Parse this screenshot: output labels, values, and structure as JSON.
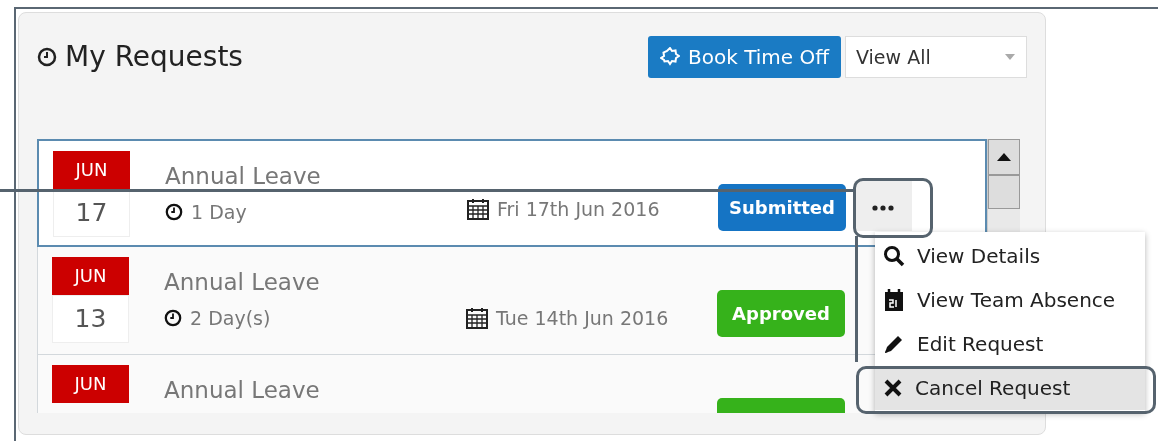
{
  "panel": {
    "title": "My Requests",
    "book_button": "Book Time Off",
    "filter": {
      "value": "View All"
    }
  },
  "requests": [
    {
      "month": "JUN",
      "day": "17",
      "title": "Annual Leave",
      "duration": "1 Day",
      "date": "Fri 17th Jun 2016",
      "status": {
        "kind": "submitted",
        "label": "Submitted"
      },
      "selected": true,
      "menu_open": true
    },
    {
      "month": "JUN",
      "day": "13",
      "title": "Annual Leave",
      "duration": "2 Day(s)",
      "date": "Tue 14th Jun 2016",
      "status": {
        "kind": "approved",
        "label": "Approved"
      },
      "selected": false,
      "menu_open": false
    },
    {
      "month": "JUN",
      "title": "Annual Leave",
      "status": {
        "kind": "approved"
      },
      "selected": false,
      "menu_open": false
    }
  ],
  "actions_menu": {
    "button_callout": true,
    "items": [
      {
        "kind": "details",
        "label": "View Details",
        "highlighted": false,
        "callout": false
      },
      {
        "kind": "team",
        "label": "View Team Absence",
        "highlighted": false,
        "callout": false
      },
      {
        "kind": "edit",
        "label": "Edit Request",
        "highlighted": false,
        "callout": false
      },
      {
        "kind": "cancel",
        "label": "Cancel Request",
        "highlighted": true,
        "callout": true
      }
    ]
  }
}
